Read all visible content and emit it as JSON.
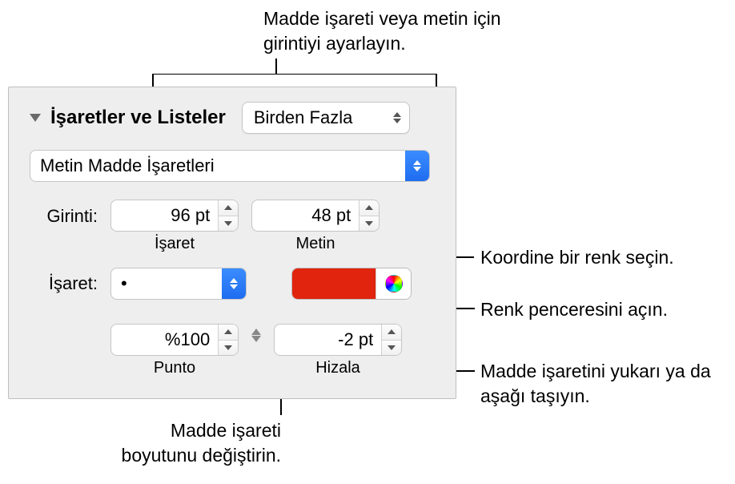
{
  "annotations": {
    "indent": "Madde işareti veya metin için girintiyi ayarlayın.",
    "coord_color": "Koordine bir renk seçin.",
    "open_color_window": "Renk penceresini açın.",
    "move_bullet": "Madde işaretini yukarı ya da aşağı taşıyın.",
    "change_size": "Madde işareti boyutunu değiştirin."
  },
  "panel": {
    "section_title": "İşaretler ve Listeler",
    "style_popup": "Birden Fazla",
    "type_popup": "Metin Madde İşaretleri",
    "indent_label": "Girinti:",
    "indent_bullet_value": "96 pt",
    "indent_bullet_sublabel": "İşaret",
    "indent_text_value": "48 pt",
    "indent_text_sublabel": "Metin",
    "bullet_label": "İşaret:",
    "bullet_char": "•",
    "color_hex": "#e0240e",
    "size_value": "%100",
    "size_sublabel": "Punto",
    "align_value": "-2 pt",
    "align_sublabel": "Hizala"
  }
}
